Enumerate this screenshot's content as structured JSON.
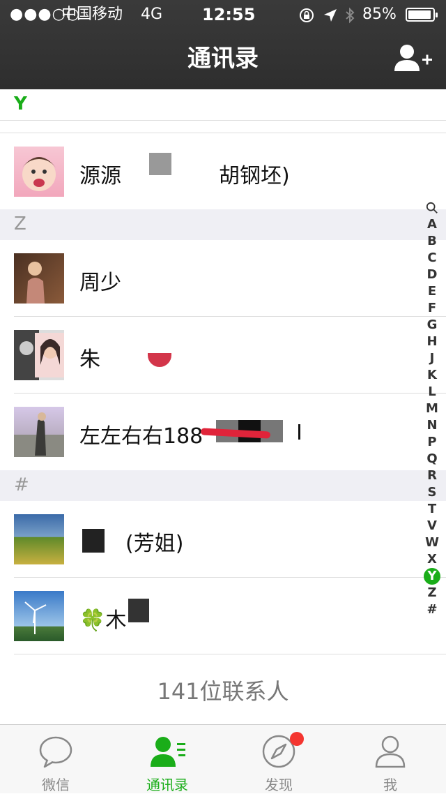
{
  "status_bar": {
    "signal": "●●●○○",
    "carrier": "中国移动",
    "network": "4G",
    "time": "12:55",
    "battery": "85%"
  },
  "header": {
    "title": "通讯录"
  },
  "sections": [
    {
      "letter": "Y",
      "contacts": [
        {
          "name": "源源",
          "name_tail": "胡钢坯)"
        }
      ]
    },
    {
      "letter": "Z",
      "contacts": [
        {
          "name": "周少"
        },
        {
          "name": "朱"
        },
        {
          "name": "左左右右188"
        }
      ]
    },
    {
      "letter": "#",
      "contacts": [
        {
          "name": "(芳姐)"
        },
        {
          "name": "🍀木"
        }
      ]
    }
  ],
  "index_bar": [
    "Q",
    "A",
    "B",
    "C",
    "D",
    "E",
    "F",
    "G",
    "H",
    "J",
    "K",
    "L",
    "M",
    "N",
    "P",
    "Q",
    "R",
    "S",
    "T",
    "V",
    "W",
    "X",
    "Y",
    "Z",
    "#"
  ],
  "index_active": "Y",
  "footer": {
    "count_text": "141位联系人"
  },
  "tabs": [
    {
      "label": "微信",
      "icon": "chat-bubble-icon"
    },
    {
      "label": "通讯录",
      "icon": "contacts-icon",
      "active": true
    },
    {
      "label": "发现",
      "icon": "compass-icon",
      "badge": true
    },
    {
      "label": "我",
      "icon": "person-icon"
    }
  ],
  "colors": {
    "accent": "#1aad19",
    "header_bg": "#2e2e2e",
    "badge": "#f43530"
  }
}
